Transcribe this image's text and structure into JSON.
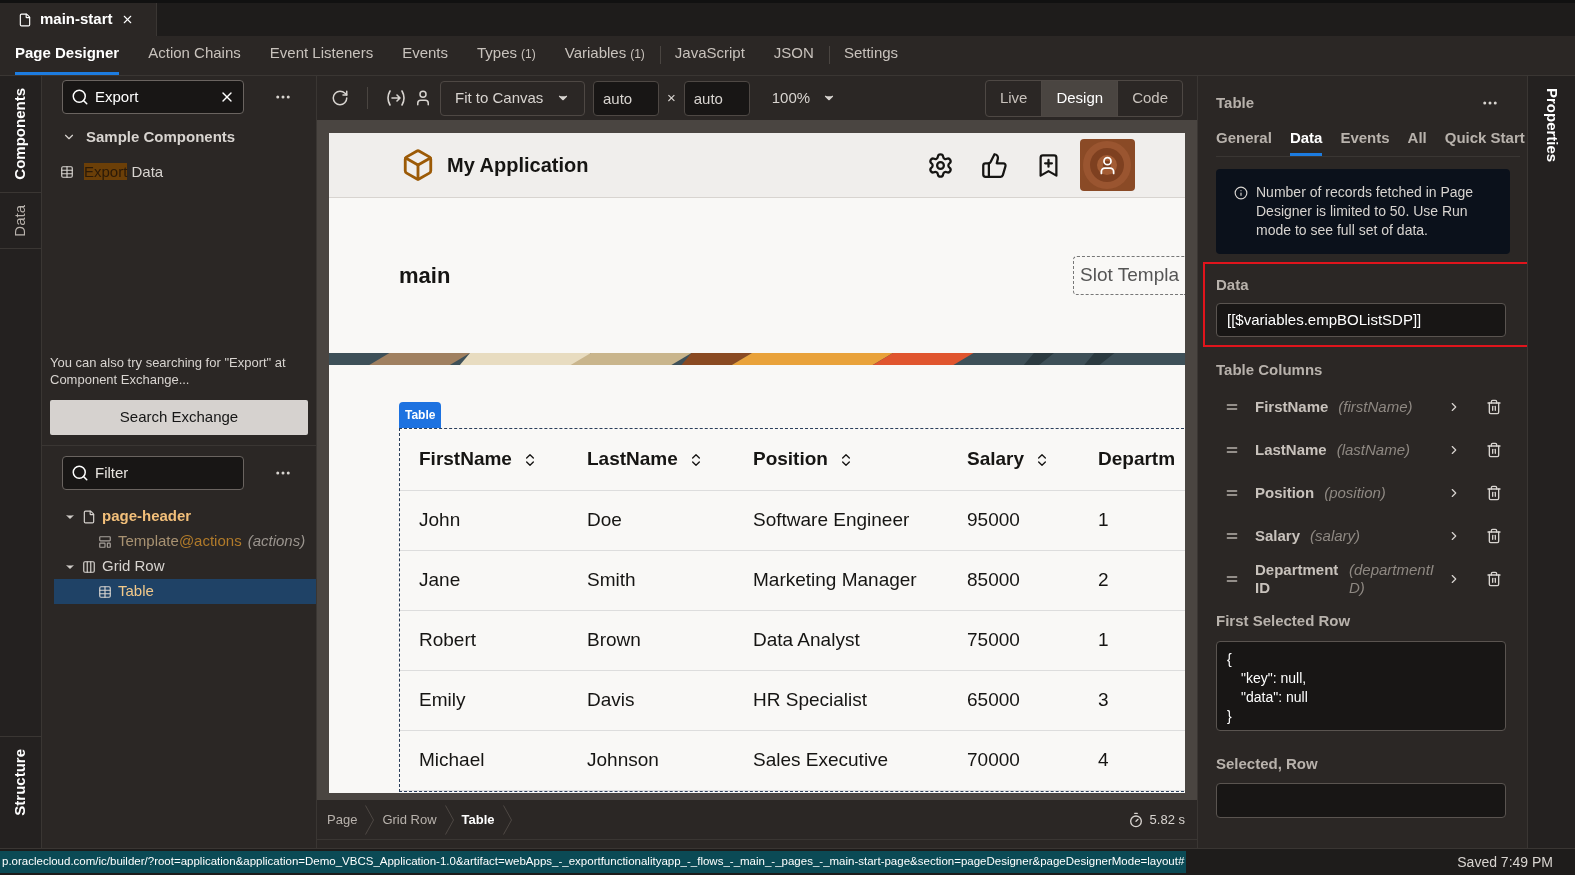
{
  "file_tab": {
    "title": "main-start",
    "selected": true
  },
  "nav_tabs": [
    {
      "label": "Page Designer",
      "selected": true
    },
    {
      "label": "Action Chains",
      "selected": false
    },
    {
      "label": "Event Listeners",
      "selected": false
    },
    {
      "label": "Events",
      "selected": false
    },
    {
      "label": "Types",
      "count": "(1)",
      "selected": false
    },
    {
      "label": "Variables",
      "count": "(1)",
      "selected": false,
      "divider_after": true
    },
    {
      "label": "JavaScript",
      "selected": false
    },
    {
      "label": "JSON",
      "selected": false,
      "divider_after": true
    },
    {
      "label": "Settings",
      "selected": false
    }
  ],
  "left_rail": {
    "top": [
      {
        "label": "Components",
        "selected": true
      },
      {
        "label": "Data",
        "selected": false
      }
    ],
    "bottom": [
      {
        "label": "Structure",
        "selected": true
      }
    ]
  },
  "components_panel": {
    "search_value": "Export",
    "section": {
      "label": "Sample Components",
      "expanded": true
    },
    "items": [
      {
        "match": "Export",
        "rest": "Data"
      }
    ],
    "hint": "You can also try searching for \"Export\" at Component Exchange...",
    "button": "Search Exchange"
  },
  "structure_panel": {
    "filter_placeholder": "Filter",
    "tree": [
      {
        "kind": "page",
        "label": "page-header",
        "expanded": true,
        "selected": false,
        "children": [
          {
            "kind": "template",
            "label": "Template",
            "slot": "@actions",
            "note": "(actions)",
            "selected": false
          }
        ]
      },
      {
        "kind": "grid",
        "label": "Grid Row",
        "expanded": true,
        "selected": false,
        "children": [
          {
            "kind": "table",
            "label": "Table",
            "selected": true
          }
        ]
      }
    ]
  },
  "toolbar": {
    "fit": "Fit to Canvas",
    "width": "auto",
    "times": "×",
    "height": "auto",
    "zoom": "100%",
    "modes": [
      {
        "label": "Live",
        "selected": false
      },
      {
        "label": "Design",
        "selected": true
      },
      {
        "label": "Code",
        "selected": false
      }
    ]
  },
  "preview": {
    "app_title": "My Application",
    "page_title": "main",
    "slot": "Slot Templa",
    "table_tag": "Table",
    "columns": [
      "FirstName",
      "LastName",
      "Position",
      "Salary",
      "Departm"
    ],
    "rows": [
      [
        "John",
        "Doe",
        "Software Engineer",
        "95000",
        "1"
      ],
      [
        "Jane",
        "Smith",
        "Marketing Manager",
        "85000",
        "2"
      ],
      [
        "Robert",
        "Brown",
        "Data Analyst",
        "75000",
        "1"
      ],
      [
        "Emily",
        "Davis",
        "HR Specialist",
        "65000",
        "3"
      ],
      [
        "Michael",
        "Johnson",
        "Sales Executive",
        "70000",
        "4"
      ]
    ]
  },
  "breadcrumbs": [
    {
      "label": "Page",
      "selected": false
    },
    {
      "label": "Grid Row",
      "selected": false
    },
    {
      "label": "Table",
      "selected": true
    }
  ],
  "timer": "5.82 s",
  "properties": {
    "title": "Table",
    "tabs": [
      {
        "label": "General",
        "selected": false
      },
      {
        "label": "Data",
        "selected": true
      },
      {
        "label": "Events",
        "selected": false
      },
      {
        "label": "All",
        "selected": false
      },
      {
        "label": "Quick Start",
        "selected": false
      }
    ],
    "info": "Number of records fetched in Page Designer is limited to 50. Use Run mode to see full set of data.",
    "data_label": "Data",
    "data_value": "[[$variables.empBOListSDP]]",
    "columns_label": "Table Columns",
    "columns": [
      {
        "name": "FirstName",
        "field": "(firstName)"
      },
      {
        "name": "LastName",
        "field": "(lastName)"
      },
      {
        "name": "Position",
        "field": "(position)"
      },
      {
        "name": "Salary",
        "field": "(salary)"
      },
      {
        "name": "DepartmentID",
        "field": "(departmentID)"
      }
    ],
    "first_selected_label": "First Selected Row",
    "first_selected_lines": [
      "{",
      "\"key\": null,",
      "\"data\": null",
      "}"
    ],
    "selected_row_label": "Selected, Row"
  },
  "right_rail": [
    {
      "label": "Properties",
      "selected": true
    }
  ],
  "status_bar": {
    "url": "p.oraclecloud.com/ic/builder/?root=application&application=Demo_VBCS_Application-1.0&artifact=webApps_-_exportfunctionalityapp_-_flows_-_main_-_pages_-_main-start-page&section=pageDesigner&pageDesignerMode=layout#",
    "saved": "Saved 7:49 PM"
  }
}
